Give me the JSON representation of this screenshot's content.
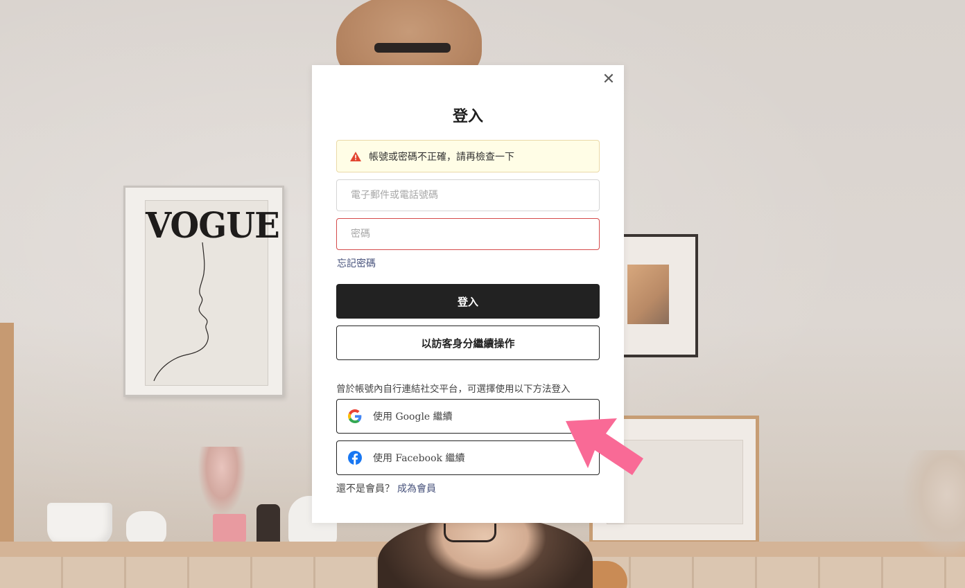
{
  "background": {
    "poster_text": "VOGUE"
  },
  "modal": {
    "title": "登入",
    "close_symbol": "✕",
    "alert": {
      "icon": "warning-icon",
      "text": "帳號或密碼不正確，請再檢查一下"
    },
    "email_field": {
      "placeholder": "電子郵件或電話號碼",
      "value": ""
    },
    "password_field": {
      "placeholder": "密碼",
      "value": ""
    },
    "forgot_password": "忘記密碼",
    "login_button": "登入",
    "guest_button": "以訪客身分繼續操作",
    "social_note": "曾於帳號內自行連結社交平台，可選擇使用以下方法登入",
    "google_button": "使用 Google 繼續",
    "facebook_button": "使用 Facebook 繼續",
    "signup_prompt": "還不是會員？",
    "signup_link": "成為會員"
  },
  "colors": {
    "error_border": "#d54a4a",
    "alert_bg": "#fffde6",
    "link": "#45507a",
    "primary_button": "#222222",
    "annotation_arrow": "#f96a96"
  }
}
